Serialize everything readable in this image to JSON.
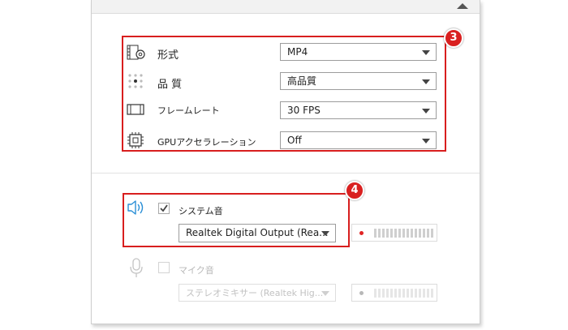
{
  "video_settings": {
    "format": {
      "label": "形式",
      "value": "MP4"
    },
    "quality": {
      "label": "品 質",
      "value": "高品質"
    },
    "framerate": {
      "label": "フレームレート",
      "value": "30 FPS"
    },
    "gpu": {
      "label": "GPUアクセラレーション",
      "value": "Off"
    }
  },
  "audio_settings": {
    "system_sound": {
      "label": "システム音",
      "checked": true,
      "device": "Realtek Digital Output (Rea...",
      "icon": "speaker-icon"
    },
    "mic_sound": {
      "label": "マイク音",
      "checked": false,
      "device": "ステレオミキサー (Realtek Hig...",
      "icon": "microphone-icon"
    }
  },
  "badges": {
    "video": "3",
    "audio": "4"
  },
  "colors": {
    "highlight": "#d81e1e",
    "speaker_icon": "#2a8fd6",
    "meter_dot": "#e02424"
  }
}
